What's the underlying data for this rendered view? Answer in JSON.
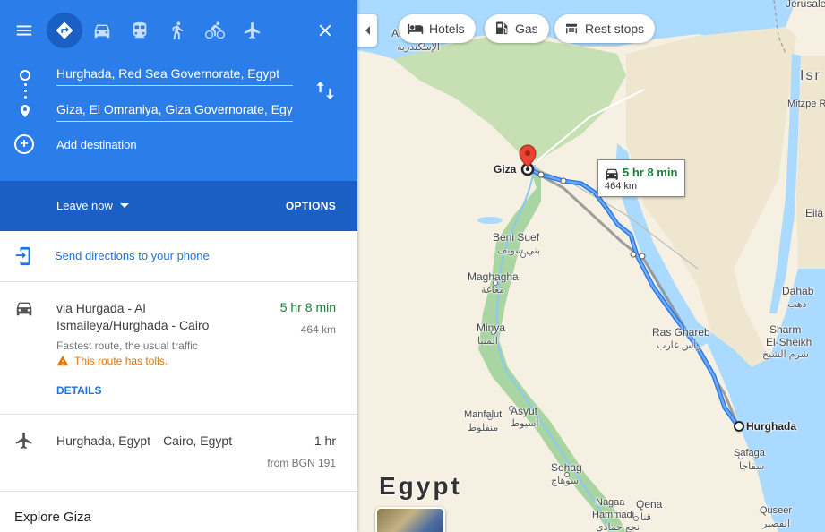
{
  "travel_modes": [
    {
      "name": "best",
      "active": true
    },
    {
      "name": "driving",
      "active": false
    },
    {
      "name": "transit",
      "active": false
    },
    {
      "name": "walking",
      "active": false
    },
    {
      "name": "cycling",
      "active": false
    },
    {
      "name": "flights",
      "active": false
    }
  ],
  "origin": "Hurghada, Red Sea Governorate, Egypt",
  "destination": "Giza, El Omraniya, Giza Governorate, Egypt",
  "add_destination": "Add destination",
  "leave_now": "Leave now",
  "options": "OPTIONS",
  "send_directions": "Send directions to your phone",
  "route": {
    "name": "via Hurgada - Al Ismaileya/Hurghada - Cairo",
    "time": "5 hr 8 min",
    "distance": "464 km",
    "description": "Fastest route, the usual traffic",
    "warning": "This route has tolls.",
    "details": "DETAILS"
  },
  "flight": {
    "route": "Hurghada, Egypt—Cairo, Egypt",
    "time": "1 hr",
    "price": "from BGN 191"
  },
  "explore": "Explore Giza",
  "map": {
    "chips": {
      "hotels": "Hotels",
      "gas": "Gas",
      "rest_stops": "Rest stops"
    },
    "bubble": {
      "time": "5 hr 8 min",
      "distance": "464 km"
    },
    "labels": {
      "alexandria_en": "Al",
      "alexandria_ar": "الإسكندرية",
      "jerusalem": "Jerusale",
      "israel": "Isr",
      "mitzpe": "Mitzpe Ra",
      "eilat": "Eila",
      "giza": "Giza",
      "beni_suef_en": "Beni Suef",
      "beni_suef_ar": "بني سويف",
      "maghagha_en": "Maghagha",
      "maghagha_ar": "مغاغة",
      "minya_en": "Minya",
      "minya_ar": "المنيا",
      "ras_ghareb_en": "Ras Ghareb",
      "ras_ghareb_ar": "رأس غارب",
      "dahab_en": "Dahab",
      "dahab_ar": "دهب",
      "sharm_en": "Sharm",
      "sharm2_en": "El-Sheikh",
      "sharm_ar": "شرم الشيخ",
      "hurghada": "Hurghada",
      "safaga_en": "Safaga",
      "safaga_ar": "سفاجا",
      "asyut_en": "Asyut",
      "asyut_ar": "أسيوط",
      "manfalut_en": "Manfalut",
      "manfalut_ar": "منفلوط",
      "sohag_en": "Sohag",
      "sohag_ar": "سوهاج",
      "nagaa_en": "Nagaa",
      "nagaa2_en": "Hammadi",
      "nagaa_ar": "نجع حمادي",
      "qena_en": "Qena",
      "qena_ar": "قنا",
      "quseer_en": "Quseer",
      "quseer_ar": "القصير",
      "egypt": "Egypt"
    }
  },
  "colors": {
    "header_blue": "#2b7de9",
    "leave_bar_blue": "#1a5fc4",
    "link_blue": "#1a73e8",
    "time_green": "#188038",
    "warning_orange": "#e37400",
    "sea_blue": "#aadaff",
    "land_beige": "#f5f0e1",
    "nile_green": "#a8d5a2",
    "route_blue": "#4285f4"
  }
}
